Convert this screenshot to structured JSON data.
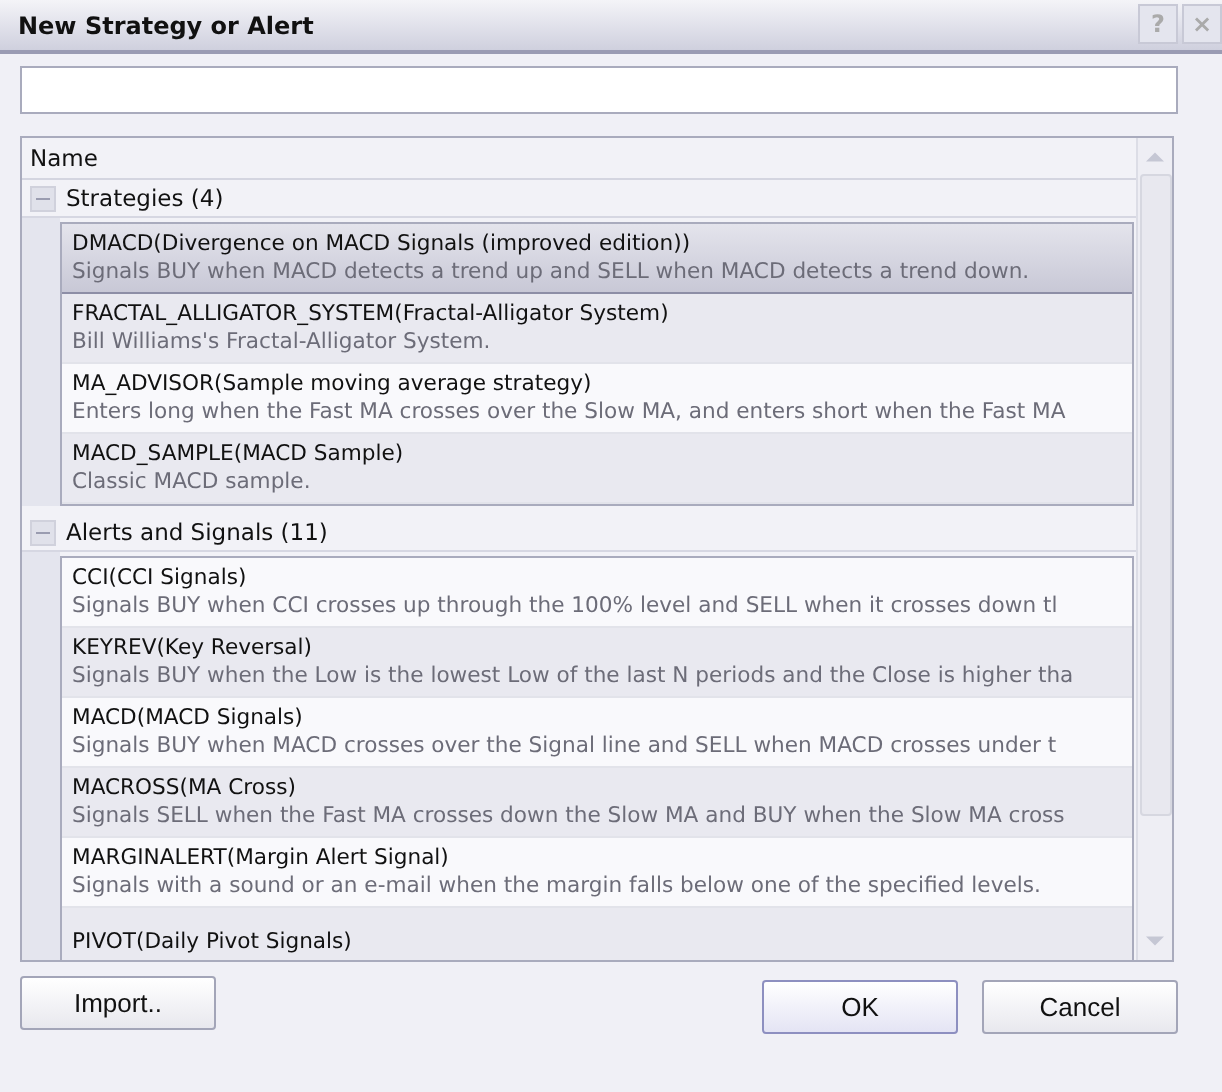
{
  "window": {
    "title": "New Strategy or Alert",
    "controls": [
      "?",
      "×"
    ]
  },
  "list": {
    "column": "Name",
    "groups": [
      {
        "label": "Strategies (4)",
        "expanded": true,
        "items": [
          {
            "name": "DMACD(Divergence on MACD Signals (improved edition))",
            "description": "Signals BUY when MACD detects a trend up and SELL when MACD detects a trend down.",
            "selected": true
          },
          {
            "name": "FRACTAL_ALLIGATOR_SYSTEM(Fractal-Alligator System)",
            "description": "Bill Williams's Fractal-Alligator System.",
            "selected": false
          },
          {
            "name": "MA_ADVISOR(Sample moving average strategy)",
            "description": "Enters long when the Fast MA crosses over the Slow MA, and enters short when the Fast MA",
            "selected": false
          },
          {
            "name": "MACD_SAMPLE(MACD Sample)",
            "description": "Classic MACD sample.",
            "selected": false
          }
        ]
      },
      {
        "label": "Alerts and Signals (11)",
        "expanded": true,
        "items": [
          {
            "name": "CCI(CCI Signals)",
            "description": "Signals BUY when CCI crosses up through the 100% level and SELL when it crosses down tl",
            "selected": false
          },
          {
            "name": "KEYREV(Key Reversal)",
            "description": "Signals BUY when the Low is the lowest Low of the last N periods and the Close is higher tha",
            "selected": false
          },
          {
            "name": "MACD(MACD Signals)",
            "description": "Signals BUY when MACD crosses over the Signal line and SELL when MACD crosses under t",
            "selected": false
          },
          {
            "name": "MACROSS(MA Cross)",
            "description": "Signals SELL when the Fast MA crosses down the Slow MA and BUY when the Slow MA cross",
            "selected": false
          },
          {
            "name": "MARGINALERT(Margin Alert Signal)",
            "description": "Signals with a sound or an e-mail when the margin falls below one of the specified levels.",
            "selected": false
          },
          {
            "name": "PIVOT(Daily Pivot Signals)",
            "selected": false
          }
        ]
      }
    ]
  },
  "buttons": {
    "import": "Import..",
    "ok": "OK",
    "cancel": "Cancel"
  }
}
